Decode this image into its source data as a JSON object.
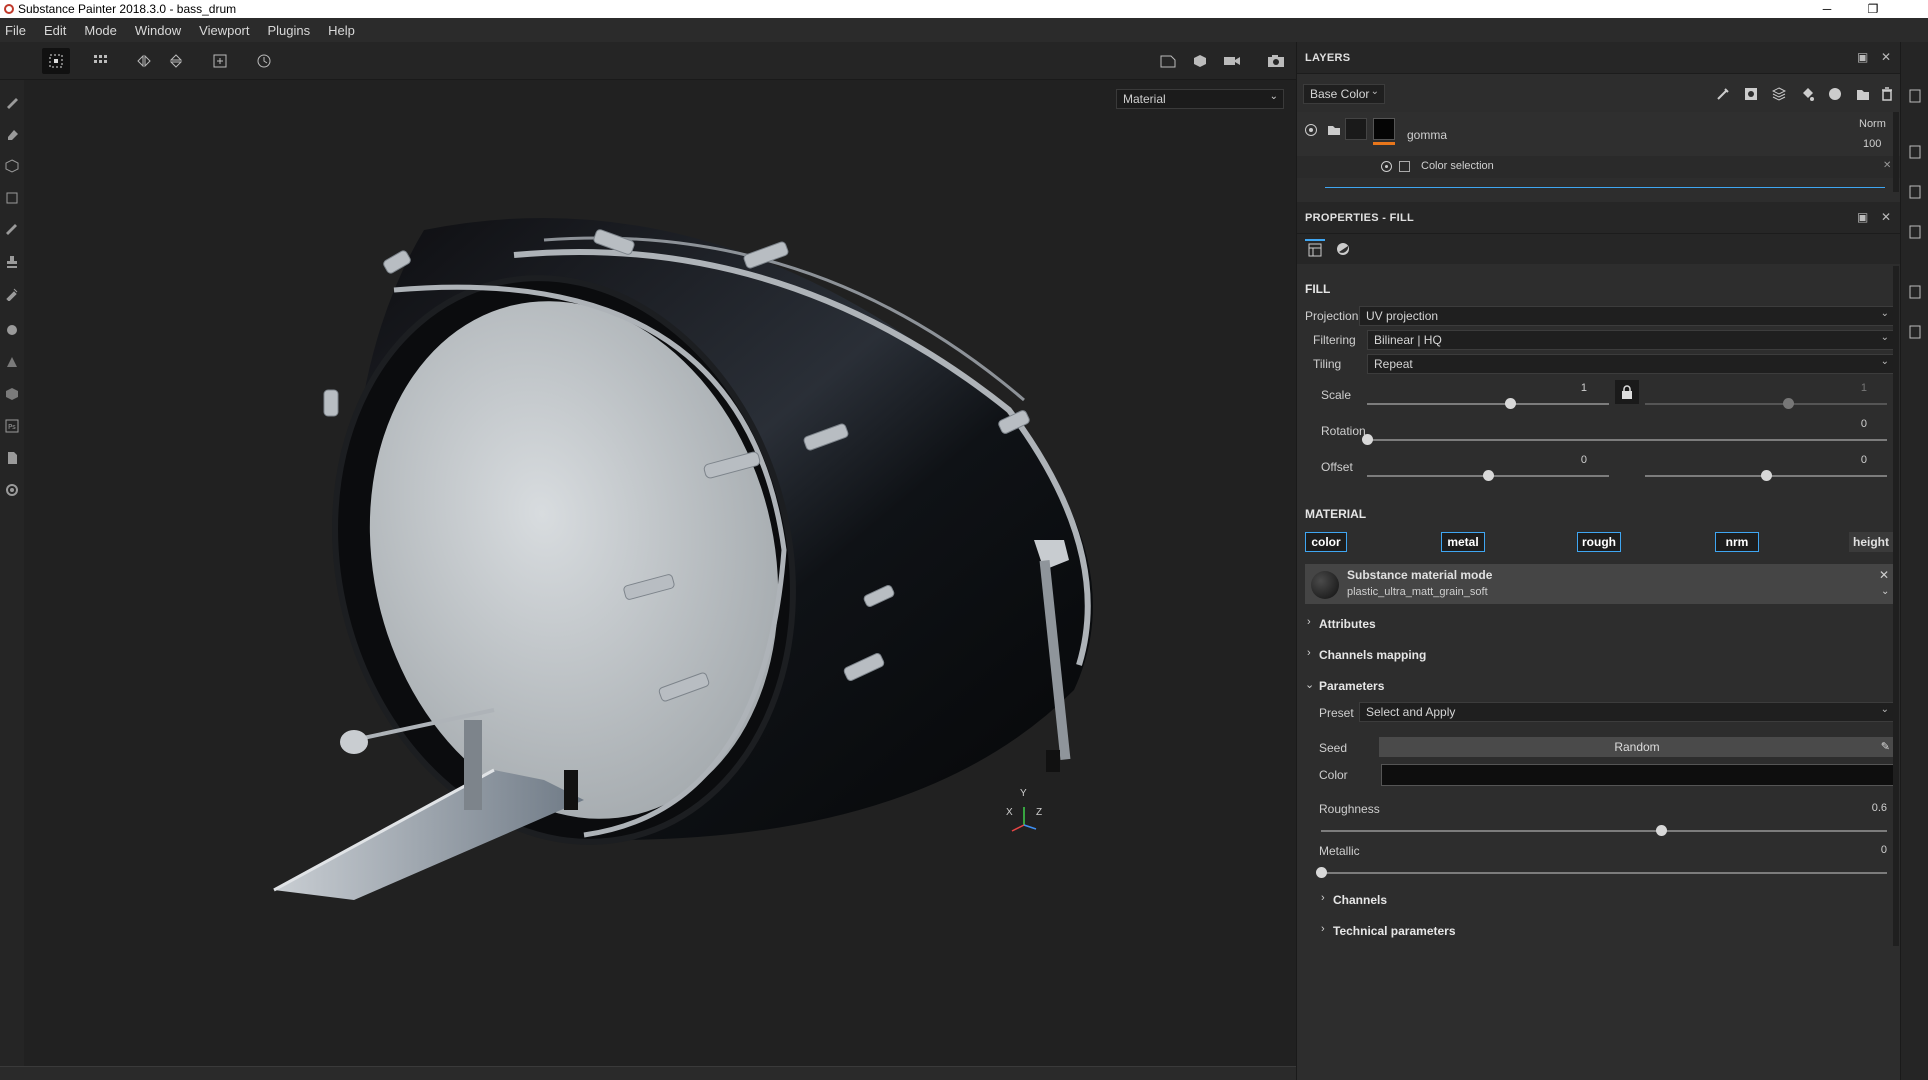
{
  "window": {
    "title": "Substance Painter 2018.3.0 - bass_drum"
  },
  "menu": [
    "File",
    "Edit",
    "Mode",
    "Window",
    "Viewport",
    "Plugins",
    "Help"
  ],
  "viewport": {
    "display_mode": "Material",
    "axis": {
      "y": "Y",
      "x": "X",
      "z": "Z"
    }
  },
  "layers": {
    "title": "LAYERS",
    "channel": "Base Color",
    "items": [
      {
        "name": "gomma",
        "blend": "Norm",
        "opacity": "100"
      },
      {
        "name": "Color selection"
      }
    ],
    "partial_blend": "Norm"
  },
  "properties": {
    "title": "PROPERTIES - FILL",
    "fill_title": "FILL",
    "projection": {
      "label": "Projection",
      "value": "UV projection"
    },
    "filtering": {
      "label": "Filtering",
      "value": "Bilinear | HQ"
    },
    "tiling": {
      "label": "Tiling",
      "value": "Repeat"
    },
    "scale": {
      "label": "Scale",
      "value1": "1",
      "value2": "1",
      "fraction1": 0.59,
      "fraction2": 0.59
    },
    "rotation": {
      "label": "Rotation",
      "value": "0",
      "fraction": 0.0
    },
    "offset": {
      "label": "Offset",
      "value1": "0",
      "value2": "0",
      "fraction1": 0.5,
      "fraction2": 0.5
    },
    "material_title": "MATERIAL",
    "channels": [
      {
        "label": "color",
        "active": true
      },
      {
        "label": "metal",
        "active": true
      },
      {
        "label": "rough",
        "active": true
      },
      {
        "label": "nrm",
        "active": true
      },
      {
        "label": "height",
        "active": false
      }
    ],
    "substance": {
      "mode": "Substance material mode",
      "name": "plastic_ultra_matt_grain_soft"
    },
    "sections": {
      "attributes": "Attributes",
      "channels_mapping": "Channels mapping",
      "parameters": "Parameters",
      "channels": "Channels",
      "technical": "Technical parameters"
    },
    "preset": {
      "label": "Preset",
      "value": "Select and Apply"
    },
    "seed": {
      "label": "Seed",
      "value": "Random"
    },
    "color": {
      "label": "Color",
      "value": "#0e0e0e"
    },
    "roughness": {
      "label": "Roughness",
      "value": "0.6",
      "fraction": 0.6
    },
    "metallic": {
      "label": "Metallic",
      "value": "0",
      "fraction": 0.0
    }
  },
  "colors": {
    "accent": "#3fa6f2",
    "panel": "#2d2d2d",
    "viewport": "#212121"
  }
}
